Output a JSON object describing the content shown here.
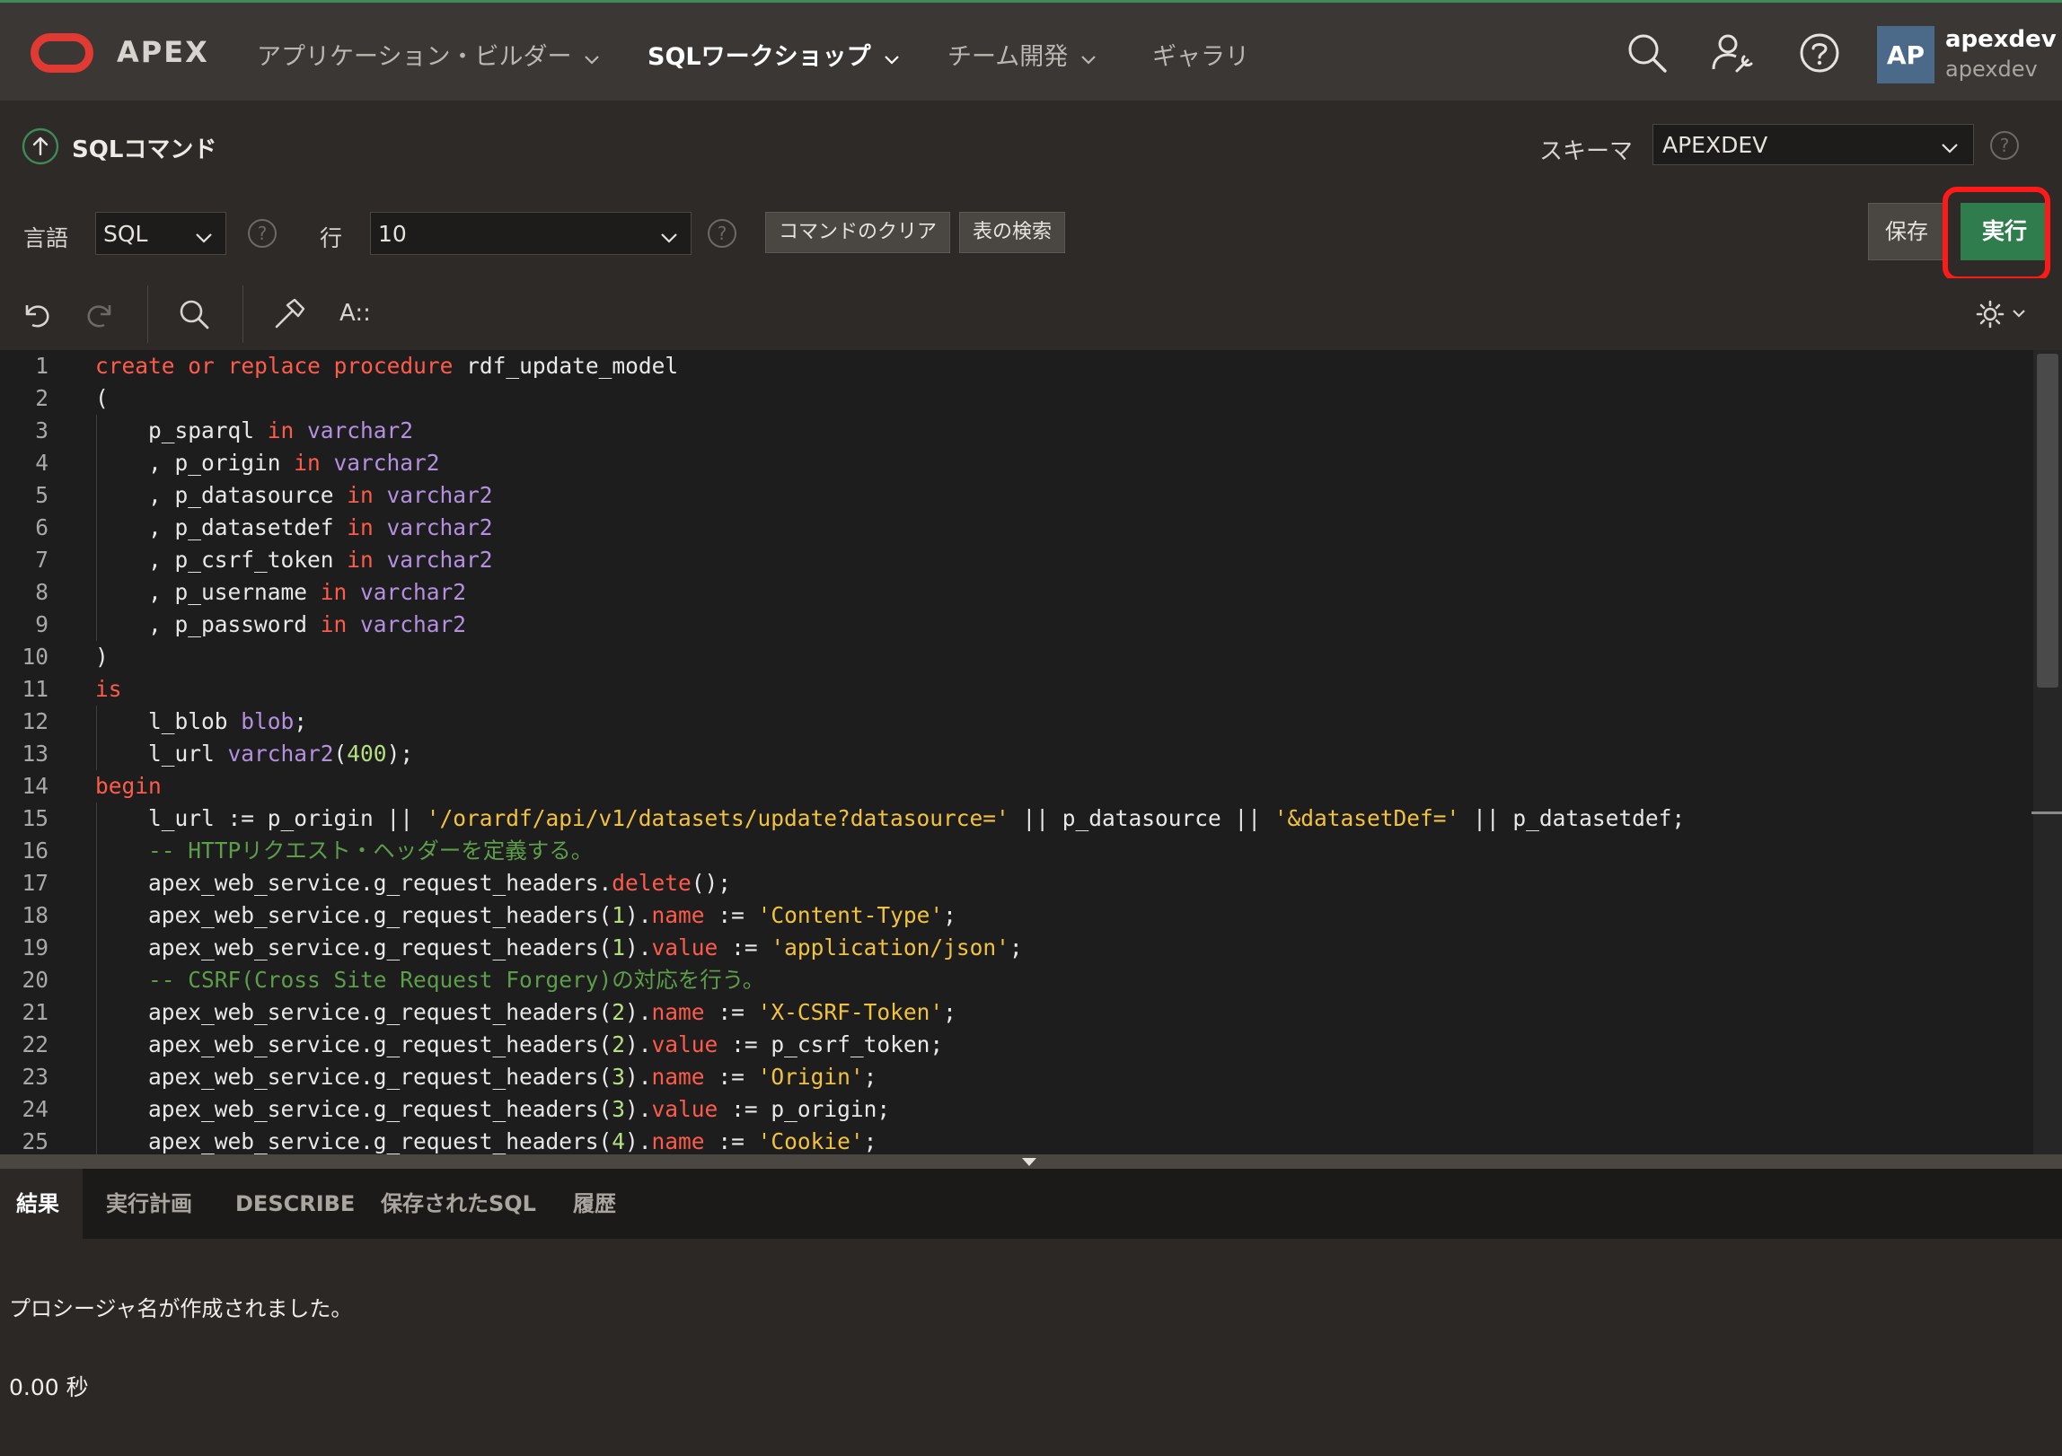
{
  "header": {
    "brand": "APEX",
    "nav": [
      {
        "label": "アプリケーション・ビルダー",
        "active": false
      },
      {
        "label": "SQLワークショップ",
        "active": true
      },
      {
        "label": "チーム開発",
        "active": false
      },
      {
        "label": "ギャラリ",
        "active": false
      }
    ],
    "user": {
      "initials": "AP",
      "name": "apexdev",
      "workspace": "apexdev"
    }
  },
  "page": {
    "title": "SQLコマンド",
    "schema_label": "スキーマ",
    "schema_value": "APEXDEV"
  },
  "toolbar": {
    "language_label": "言語",
    "language_value": "SQL",
    "rows_label": "行",
    "rows_value": "10",
    "clear_label": "コマンドのクリア",
    "find_table_label": "表の検索",
    "save_label": "保存",
    "run_label": "実行"
  },
  "editor": {
    "format_label": "A::"
  },
  "code_lines": [
    "create or replace procedure rdf_update_model",
    "(",
    "    p_sparql in varchar2",
    "    , p_origin in varchar2",
    "    , p_datasource in varchar2",
    "    , p_datasetdef in varchar2",
    "    , p_csrf_token in varchar2",
    "    , p_username in varchar2",
    "    , p_password in varchar2",
    ")",
    "is",
    "    l_blob blob;",
    "    l_url varchar2(400);",
    "begin",
    "    l_url := p_origin || '/orardf/api/v1/datasets/update?datasource=' || p_datasource || '&datasetDef=' || p_datasetdef;",
    "    -- HTTPリクエスト・ヘッダーを定義する。",
    "    apex_web_service.g_request_headers.delete();",
    "    apex_web_service.g_request_headers(1).name := 'Content-Type';",
    "    apex_web_service.g_request_headers(1).value := 'application/json';",
    "    -- CSRF(Cross Site Request Forgery)の対応を行う。",
    "    apex_web_service.g_request_headers(2).name := 'X-CSRF-Token';",
    "    apex_web_service.g_request_headers(2).value := p_csrf_token;",
    "    apex_web_service.g_request_headers(3).name := 'Origin';",
    "    apex_web_service.g_request_headers(3).value := p_origin;",
    "    apex_web_service.g_request_headers(4).name := 'Cookie';"
  ],
  "tabs": [
    {
      "label": "結果",
      "active": true
    },
    {
      "label": "実行計画",
      "active": false
    },
    {
      "label": "DESCRIBE",
      "active": false
    },
    {
      "label": "保存されたSQL",
      "active": false
    },
    {
      "label": "履歴",
      "active": false
    }
  ],
  "results": {
    "message": "プロシージャ名が作成されました。",
    "time": "0.00 秒"
  },
  "colors": {
    "accent_green": "#2f7d4d",
    "highlight_red": "#ff1a1a",
    "logo_red": "#e03a33"
  }
}
